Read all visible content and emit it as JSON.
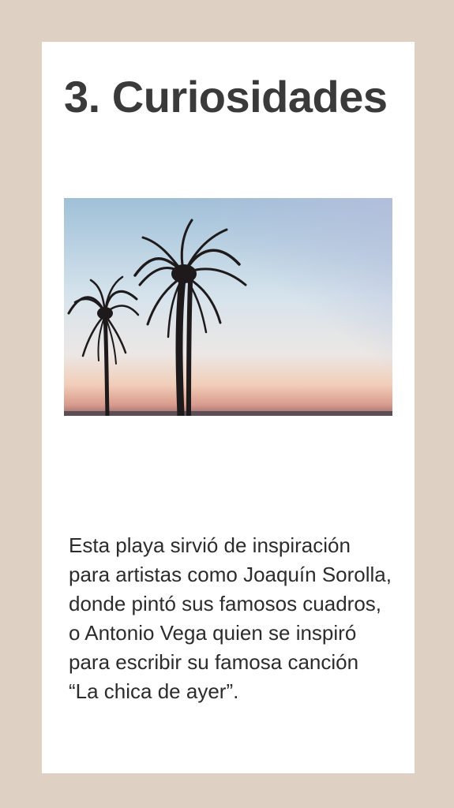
{
  "card": {
    "title": "3. Curiosidades",
    "body": "Esta playa sirvió de inspiración para artistas como Joaquín Sorolla, donde pintó sus famosos cuadros, o Antonio Vega quien se inspiró para escribir su famosa canción “La chica de ayer”.",
    "photo_icon": "palm-trees-sunset-photo"
  },
  "colors": {
    "background": "#dfd0c4",
    "card": "#ffffff",
    "title": "#3a3a3a",
    "text": "#2c2c2c"
  }
}
